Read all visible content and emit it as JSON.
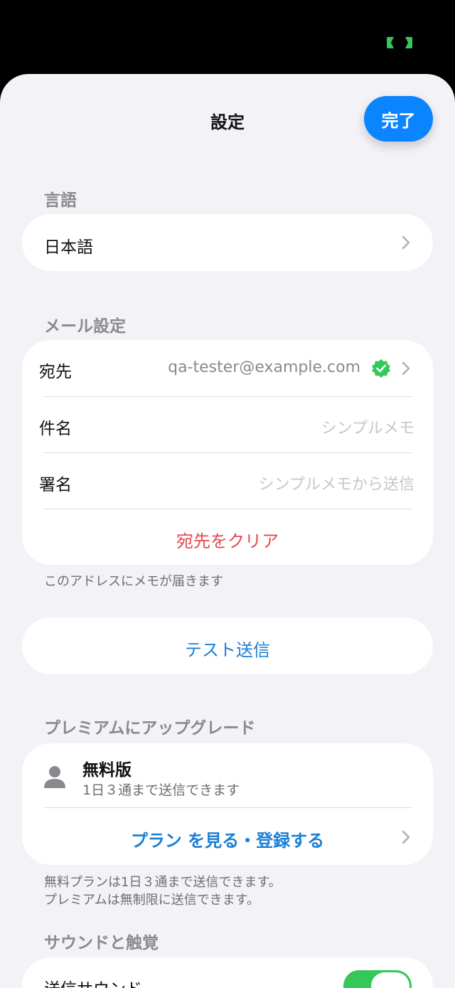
{
  "nav": {
    "title": "設定",
    "done_label": "完了"
  },
  "language": {
    "header": "言語",
    "value": "日本語"
  },
  "mail": {
    "header": "メール設定",
    "to_label": "宛先",
    "to_value": "qa-tester@example.com",
    "subject_label": "件名",
    "subject_placeholder": "シンプルメモ",
    "signature_label": "署名",
    "signature_placeholder": "シンプルメモから送信",
    "clear_label": "宛先をクリア",
    "footer": "このアドレスにメモが届きます"
  },
  "test_send": {
    "label": "テスト送信"
  },
  "premium": {
    "header": "プレミアムにアップグレード",
    "plan_name": "無料版",
    "plan_desc": "1日３通まで送信できます",
    "link_label": "プラン を見る・登録する",
    "footer_line1": "無料プランは1日３通まで送信できます。",
    "footer_line2": "プレミアムは無制限に送信できます。"
  },
  "sound": {
    "header": "サウンドと触覚",
    "send_sound_label": "送信サウンド",
    "send_sound_on": true
  },
  "colors": {
    "accent": "#0a84ff",
    "destructive": "#e5484d",
    "verified": "#34c759"
  }
}
